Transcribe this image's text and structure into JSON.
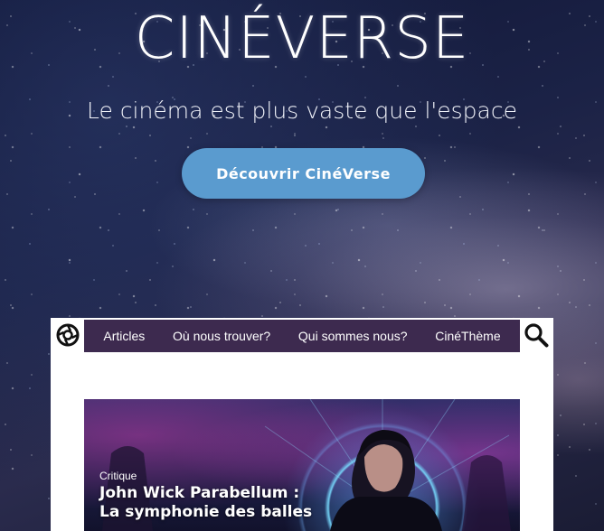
{
  "hero": {
    "title": "CINÉVERSE",
    "tagline": "Le cinéma est plus vaste que l'espace",
    "cta_label": "Découvrir CinéVerse"
  },
  "nav": {
    "items": [
      {
        "label": "Articles"
      },
      {
        "label": "Où nous trouver?"
      },
      {
        "label": "Qui sommes nous?"
      },
      {
        "label": "CinéThème"
      }
    ]
  },
  "featured": {
    "category": "Critique",
    "title_line1": "John Wick Parabellum :",
    "title_line2": "La symphonie des balles"
  },
  "colors": {
    "nav_background": "#3d2a4f",
    "cta_background": "#5a9bcf",
    "panel_background": "#ffffff"
  },
  "icons": {
    "logo": "logo-icon",
    "search": "search-icon"
  }
}
